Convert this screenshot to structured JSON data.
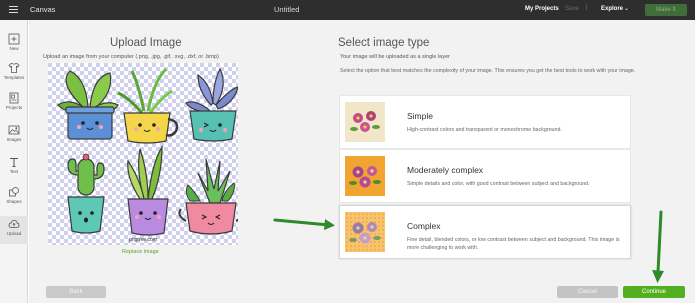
{
  "topbar": {
    "app_name": "Canvas",
    "document_title": "Untitled",
    "my_projects": "My Projects",
    "save": "Save",
    "separator": "|",
    "explore": "Explore",
    "make_it": "Make It"
  },
  "rail": {
    "items": [
      {
        "label": "New",
        "icon": "plus-icon"
      },
      {
        "label": "Templates",
        "icon": "shirt-icon"
      },
      {
        "label": "Projects",
        "icon": "projects-icon"
      },
      {
        "label": "Images",
        "icon": "images-icon"
      },
      {
        "label": "Text",
        "icon": "text-icon"
      },
      {
        "label": "Shapes",
        "icon": "shapes-icon"
      },
      {
        "label": "Upload",
        "icon": "upload-icon"
      }
    ]
  },
  "upload": {
    "heading": "Upload Image",
    "description": "Upload an image from your computer (.png, .jpg, .gif, .svg, .dxf, or .bmp)",
    "image_watermark": "pngtree.com",
    "replace_label": "Replace image"
  },
  "select": {
    "heading": "Select image type",
    "subheading": "Your image will be uploaded as a single layer",
    "instructions": "Select the option that best matches the complexity of your image. This ensures you get the best tools to work with your image.",
    "options": [
      {
        "title": "Simple",
        "description": "High-contrast colors and transparent or monochrome background.",
        "thumb_bg": "#f2e6c8"
      },
      {
        "title": "Moderately complex",
        "description": "Simple details and color, with good contrast between subject and background.",
        "thumb_bg": "#f1a431"
      },
      {
        "title": "Complex",
        "description": "Fine detail, blended colors, or low contrast between subject and background. This image is more challenging to work with.",
        "thumb_bg": "#f6c46a"
      }
    ]
  },
  "footer": {
    "back": "Back",
    "cancel": "Cancel",
    "continue": "Continue"
  },
  "colors": {
    "accent_green": "#52b020",
    "arrow_green": "#2f8a2a",
    "topbar": "#2e2e2e"
  }
}
